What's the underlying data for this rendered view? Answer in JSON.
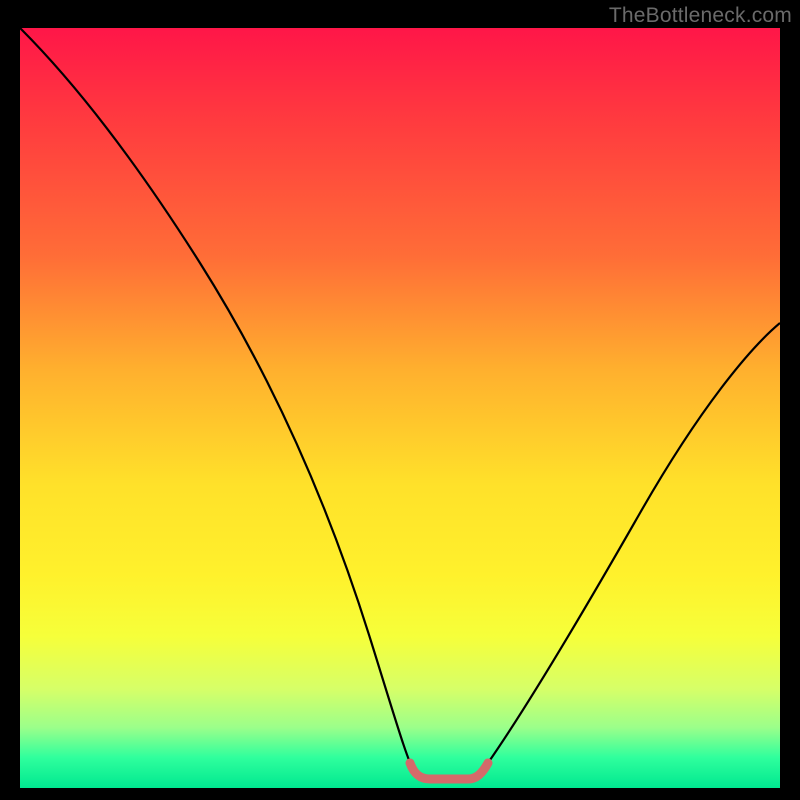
{
  "watermark": "TheBottleneck.com",
  "chart_data": {
    "type": "line",
    "title": "",
    "xlabel": "",
    "ylabel": "",
    "xlim": [
      0,
      100
    ],
    "ylim": [
      0,
      100
    ],
    "series": [
      {
        "name": "curve",
        "x": [
          0,
          5,
          10,
          15,
          20,
          25,
          30,
          35,
          40,
          45,
          47.5,
          50,
          52.5,
          55,
          57,
          58,
          60,
          62,
          64,
          66,
          70,
          75,
          80,
          85,
          90,
          95,
          100
        ],
        "y": [
          100,
          93,
          86,
          79,
          71,
          62,
          52,
          40,
          27,
          12,
          5,
          1.5,
          1,
          1,
          1,
          1.5,
          3,
          6,
          9,
          13,
          20,
          28,
          36,
          43,
          50,
          56,
          61
        ]
      },
      {
        "name": "highlight",
        "x": [
          50,
          52,
          54,
          56,
          58
        ],
        "y": [
          1.5,
          1,
          1,
          1,
          1.5
        ]
      }
    ],
    "colors": {
      "curve": "#000000",
      "highlight": "#d46a6a",
      "gradient_top": "#ff1648",
      "gradient_bottom": "#00e890"
    }
  }
}
